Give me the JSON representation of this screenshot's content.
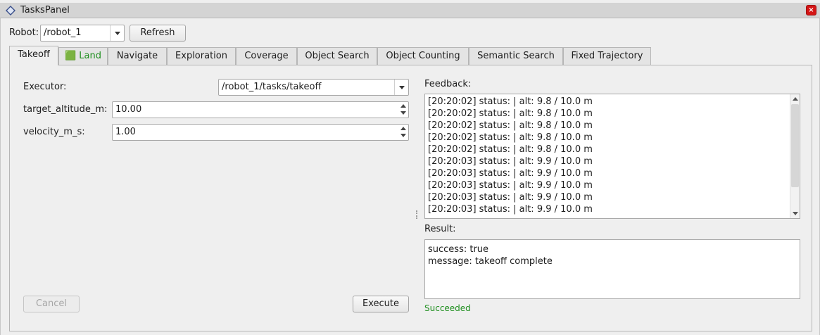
{
  "window": {
    "title": "TasksPanel",
    "close_label": "×"
  },
  "robot_bar": {
    "label": "Robot:",
    "selected": "/robot_1",
    "refresh_label": "Refresh"
  },
  "tabs": [
    {
      "label": "Takeoff"
    },
    {
      "label": "🟩 Land"
    },
    {
      "label": "Navigate"
    },
    {
      "label": "Exploration"
    },
    {
      "label": "Coverage"
    },
    {
      "label": "Object Search"
    },
    {
      "label": "Object Counting"
    },
    {
      "label": "Semantic Search"
    },
    {
      "label": "Fixed Trajectory"
    }
  ],
  "form": {
    "executor_label": "Executor:",
    "executor_value": "/robot_1/tasks/takeoff",
    "altitude_label": "target_altitude_m:",
    "altitude_value": "10.00",
    "velocity_label": "velocity_m_s:",
    "velocity_value": "1.00",
    "cancel_label": "Cancel",
    "execute_label": "Execute"
  },
  "feedback": {
    "label": "Feedback:",
    "lines": [
      "[20:20:02] status:  | alt: 9.8 / 10.0 m",
      "[20:20:02] status:  | alt: 9.8 / 10.0 m",
      "[20:20:02] status:  | alt: 9.8 / 10.0 m",
      "[20:20:02] status:  | alt: 9.8 / 10.0 m",
      "[20:20:02] status:  | alt: 9.8 / 10.0 m",
      "[20:20:03] status:  | alt: 9.9 / 10.0 m",
      "[20:20:03] status:  | alt: 9.9 / 10.0 m",
      "[20:20:03] status:  | alt: 9.9 / 10.0 m",
      "[20:20:03] status:  | alt: 9.9 / 10.0 m",
      "[20:20:03] status:  | alt: 9.9 / 10.0 m"
    ]
  },
  "result": {
    "label": "Result:",
    "lines": [
      "success: true",
      "message: takeoff complete"
    ],
    "status_text": "Succeeded"
  },
  "colors": {
    "success": "#1f8f1f",
    "close_button": "#d41616"
  }
}
